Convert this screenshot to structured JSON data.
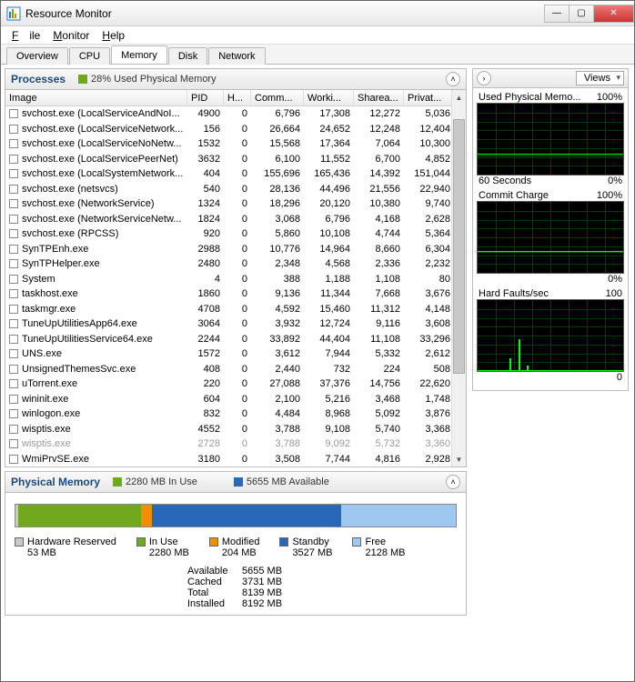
{
  "window": {
    "title": "Resource Monitor"
  },
  "menu": {
    "file": "File",
    "monitor": "Monitor",
    "help": "Help"
  },
  "tabs": {
    "overview": "Overview",
    "cpu": "CPU",
    "memory": "Memory",
    "disk": "Disk",
    "network": "Network"
  },
  "processes": {
    "title": "Processes",
    "usage_label": "28% Used Physical Memory",
    "cols": {
      "image": "Image",
      "pid": "PID",
      "h": "H...",
      "comm": "Comm...",
      "work": "Worki...",
      "share": "Sharea...",
      "priv": "Privat..."
    },
    "rows": [
      {
        "img": "svchost.exe (LocalServiceAndNoI...",
        "pid": "4900",
        "h": "0",
        "comm": "6,796",
        "work": "17,308",
        "share": "12,272",
        "priv": "5,036"
      },
      {
        "img": "svchost.exe (LocalServiceNetwork...",
        "pid": "156",
        "h": "0",
        "comm": "26,664",
        "work": "24,652",
        "share": "12,248",
        "priv": "12,404"
      },
      {
        "img": "svchost.exe (LocalServiceNoNetw...",
        "pid": "1532",
        "h": "0",
        "comm": "15,568",
        "work": "17,364",
        "share": "7,064",
        "priv": "10,300"
      },
      {
        "img": "svchost.exe (LocalServicePeerNet)",
        "pid": "3632",
        "h": "0",
        "comm": "6,100",
        "work": "11,552",
        "share": "6,700",
        "priv": "4,852"
      },
      {
        "img": "svchost.exe (LocalSystemNetwork...",
        "pid": "404",
        "h": "0",
        "comm": "155,696",
        "work": "165,436",
        "share": "14,392",
        "priv": "151,044"
      },
      {
        "img": "svchost.exe (netsvcs)",
        "pid": "540",
        "h": "0",
        "comm": "28,136",
        "work": "44,496",
        "share": "21,556",
        "priv": "22,940"
      },
      {
        "img": "svchost.exe (NetworkService)",
        "pid": "1324",
        "h": "0",
        "comm": "18,296",
        "work": "20,120",
        "share": "10,380",
        "priv": "9,740"
      },
      {
        "img": "svchost.exe (NetworkServiceNetw...",
        "pid": "1824",
        "h": "0",
        "comm": "3,068",
        "work": "6,796",
        "share": "4,168",
        "priv": "2,628"
      },
      {
        "img": "svchost.exe (RPCSS)",
        "pid": "920",
        "h": "0",
        "comm": "5,860",
        "work": "10,108",
        "share": "4,744",
        "priv": "5,364"
      },
      {
        "img": "SynTPEnh.exe",
        "pid": "2988",
        "h": "0",
        "comm": "10,776",
        "work": "14,964",
        "share": "8,660",
        "priv": "6,304"
      },
      {
        "img": "SynTPHelper.exe",
        "pid": "2480",
        "h": "0",
        "comm": "2,348",
        "work": "4,568",
        "share": "2,336",
        "priv": "2,232"
      },
      {
        "img": "System",
        "pid": "4",
        "h": "0",
        "comm": "388",
        "work": "1,188",
        "share": "1,108",
        "priv": "80"
      },
      {
        "img": "taskhost.exe",
        "pid": "1860",
        "h": "0",
        "comm": "9,136",
        "work": "11,344",
        "share": "7,668",
        "priv": "3,676"
      },
      {
        "img": "taskmgr.exe",
        "pid": "4708",
        "h": "0",
        "comm": "4,592",
        "work": "15,460",
        "share": "11,312",
        "priv": "4,148"
      },
      {
        "img": "TuneUpUtilitiesApp64.exe",
        "pid": "3064",
        "h": "0",
        "comm": "3,932",
        "work": "12,724",
        "share": "9,116",
        "priv": "3,608"
      },
      {
        "img": "TuneUpUtilitiesService64.exe",
        "pid": "2244",
        "h": "0",
        "comm": "33,892",
        "work": "44,404",
        "share": "11,108",
        "priv": "33,296"
      },
      {
        "img": "UNS.exe",
        "pid": "1572",
        "h": "0",
        "comm": "3,612",
        "work": "7,944",
        "share": "5,332",
        "priv": "2,612"
      },
      {
        "img": "UnsignedThemesSvc.exe",
        "pid": "408",
        "h": "0",
        "comm": "2,440",
        "work": "732",
        "share": "224",
        "priv": "508"
      },
      {
        "img": "uTorrent.exe",
        "pid": "220",
        "h": "0",
        "comm": "27,088",
        "work": "37,376",
        "share": "14,756",
        "priv": "22,620"
      },
      {
        "img": "wininit.exe",
        "pid": "604",
        "h": "0",
        "comm": "2,100",
        "work": "5,216",
        "share": "3,468",
        "priv": "1,748"
      },
      {
        "img": "winlogon.exe",
        "pid": "832",
        "h": "0",
        "comm": "4,484",
        "work": "8,968",
        "share": "5,092",
        "priv": "3,876"
      },
      {
        "img": "wisptis.exe",
        "pid": "4552",
        "h": "0",
        "comm": "3,788",
        "work": "9,108",
        "share": "5,740",
        "priv": "3,368"
      },
      {
        "img": "wisptis.exe",
        "pid": "2728",
        "h": "0",
        "comm": "3,788",
        "work": "9,092",
        "share": "5,732",
        "priv": "3,360",
        "dim": true
      },
      {
        "img": "WmiPrvSE.exe",
        "pid": "3180",
        "h": "0",
        "comm": "3,508",
        "work": "7,744",
        "share": "4,816",
        "priv": "2,928"
      }
    ]
  },
  "physmem": {
    "title": "Physical Memory",
    "inuse_label": "2280 MB In Use",
    "avail_label": "5655 MB Available",
    "legend": {
      "hw": {
        "label": "Hardware Reserved",
        "val": "53 MB",
        "color": "#c8c8c8"
      },
      "inuse": {
        "label": "In Use",
        "val": "2280 MB",
        "color": "#70a81e"
      },
      "mod": {
        "label": "Modified",
        "val": "204 MB",
        "color": "#f09000"
      },
      "stby": {
        "label": "Standby",
        "val": "3527 MB",
        "color": "#2968b8"
      },
      "free": {
        "label": "Free",
        "val": "2128 MB",
        "color": "#9ec8f0"
      }
    },
    "stats": {
      "available": {
        "k": "Available",
        "v": "5655 MB"
      },
      "cached": {
        "k": "Cached",
        "v": "3731 MB"
      },
      "total": {
        "k": "Total",
        "v": "8139 MB"
      },
      "installed": {
        "k": "Installed",
        "v": "8192 MB"
      }
    }
  },
  "right": {
    "views": "Views",
    "g1": {
      "title": "Used Physical Memo...",
      "max": "100%",
      "footL": "60 Seconds",
      "footR": "0%"
    },
    "g2": {
      "title": "Commit Charge",
      "max": "100%",
      "footR": "0%"
    },
    "g3": {
      "title": "Hard Faults/sec",
      "max": "100",
      "footR": "0"
    }
  },
  "chart_data": [
    {
      "type": "line",
      "title": "Used Physical Memory",
      "ylim": [
        0,
        100
      ],
      "xlabel": "60 Seconds",
      "ylabel": "%",
      "series": [
        {
          "name": "used",
          "values": [
            28,
            28,
            28,
            28,
            28,
            28,
            28,
            28,
            28,
            28,
            28,
            28
          ]
        }
      ]
    },
    {
      "type": "line",
      "title": "Commit Charge",
      "ylim": [
        0,
        100
      ],
      "ylabel": "%",
      "series": [
        {
          "name": "commit",
          "values": [
            30,
            30,
            30,
            30,
            30,
            30,
            30,
            30,
            30,
            30,
            30,
            30
          ]
        }
      ]
    },
    {
      "type": "line",
      "title": "Hard Faults/sec",
      "ylim": [
        0,
        100
      ],
      "series": [
        {
          "name": "faults",
          "values": [
            0,
            0,
            18,
            45,
            8,
            0,
            0,
            0,
            0,
            0,
            0,
            0
          ]
        }
      ]
    }
  ]
}
